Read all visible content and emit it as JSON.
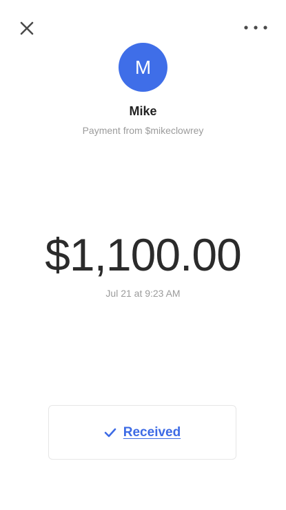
{
  "header": {
    "close_icon": "close-icon",
    "more_icon": "more-options-icon"
  },
  "payer": {
    "initial": "M",
    "name": "Mike",
    "subtitle": "Payment from $mikeclowrey"
  },
  "payment": {
    "amount": "$1,100.00",
    "timestamp": "Jul 21 at 9:23 AM"
  },
  "status": {
    "icon": "checkmark-icon",
    "label": "Received"
  },
  "colors": {
    "accent": "#3d6be5",
    "avatar_bg": "#3f6ee8",
    "text_primary": "#2b2b2b",
    "text_secondary": "#9b9b9b"
  }
}
